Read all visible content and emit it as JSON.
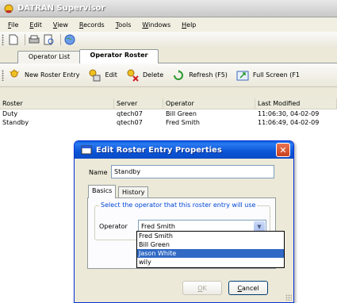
{
  "window": {
    "title": "DATRAN Supervisor"
  },
  "menu": [
    {
      "key": "F",
      "rest": "ile"
    },
    {
      "key": "E",
      "rest": "dit"
    },
    {
      "key": "V",
      "rest": "iew"
    },
    {
      "key": "R",
      "rest": "ecords"
    },
    {
      "key": "T",
      "rest": "ools"
    },
    {
      "key": "W",
      "rest": "indows"
    },
    {
      "key": "H",
      "rest": "elp"
    }
  ],
  "tabs": {
    "operator_list": "Operator List",
    "operator_roster": "Operator Roster"
  },
  "toolbar": {
    "new_entry": "New Roster Entry",
    "edit": "Edit",
    "delete": "Delete",
    "refresh": "Refresh (F5)",
    "fullscreen": "Full Screen (F1"
  },
  "list": {
    "headers": {
      "roster": "Roster",
      "server": "Server",
      "operator": "Operator",
      "last_modified": "Last Modified"
    },
    "rows": [
      {
        "roster": "Duty",
        "server": "qtech07",
        "operator": "Bill Green",
        "last_modified": "11:06:30, 04-02-09"
      },
      {
        "roster": "Standby",
        "server": "qtech07",
        "operator": "Fred Smith",
        "last_modified": "11:06:49, 04-02-09"
      }
    ]
  },
  "dialog": {
    "title": "Edit Roster Entry Properties",
    "name_label": "Name",
    "name_value": "Standby",
    "tab_basics": "Basics",
    "tab_history": "History",
    "group_caption": "Select the operator that this roster entry will use",
    "operator_label": "Operator",
    "operator_value": "Fred Smith",
    "operator_options": [
      "Fred Smith",
      "Bill Green",
      "Jason White",
      "wily"
    ],
    "selected_option": "Jason White",
    "ok_label_key": "O",
    "ok_label_rest": "K",
    "cancel_label_key": "C",
    "cancel_label_rest": "ancel"
  },
  "colors": {
    "title_blue": "#0a5bdc",
    "highlight": "#316ac5",
    "close_red": "#c8401e"
  }
}
